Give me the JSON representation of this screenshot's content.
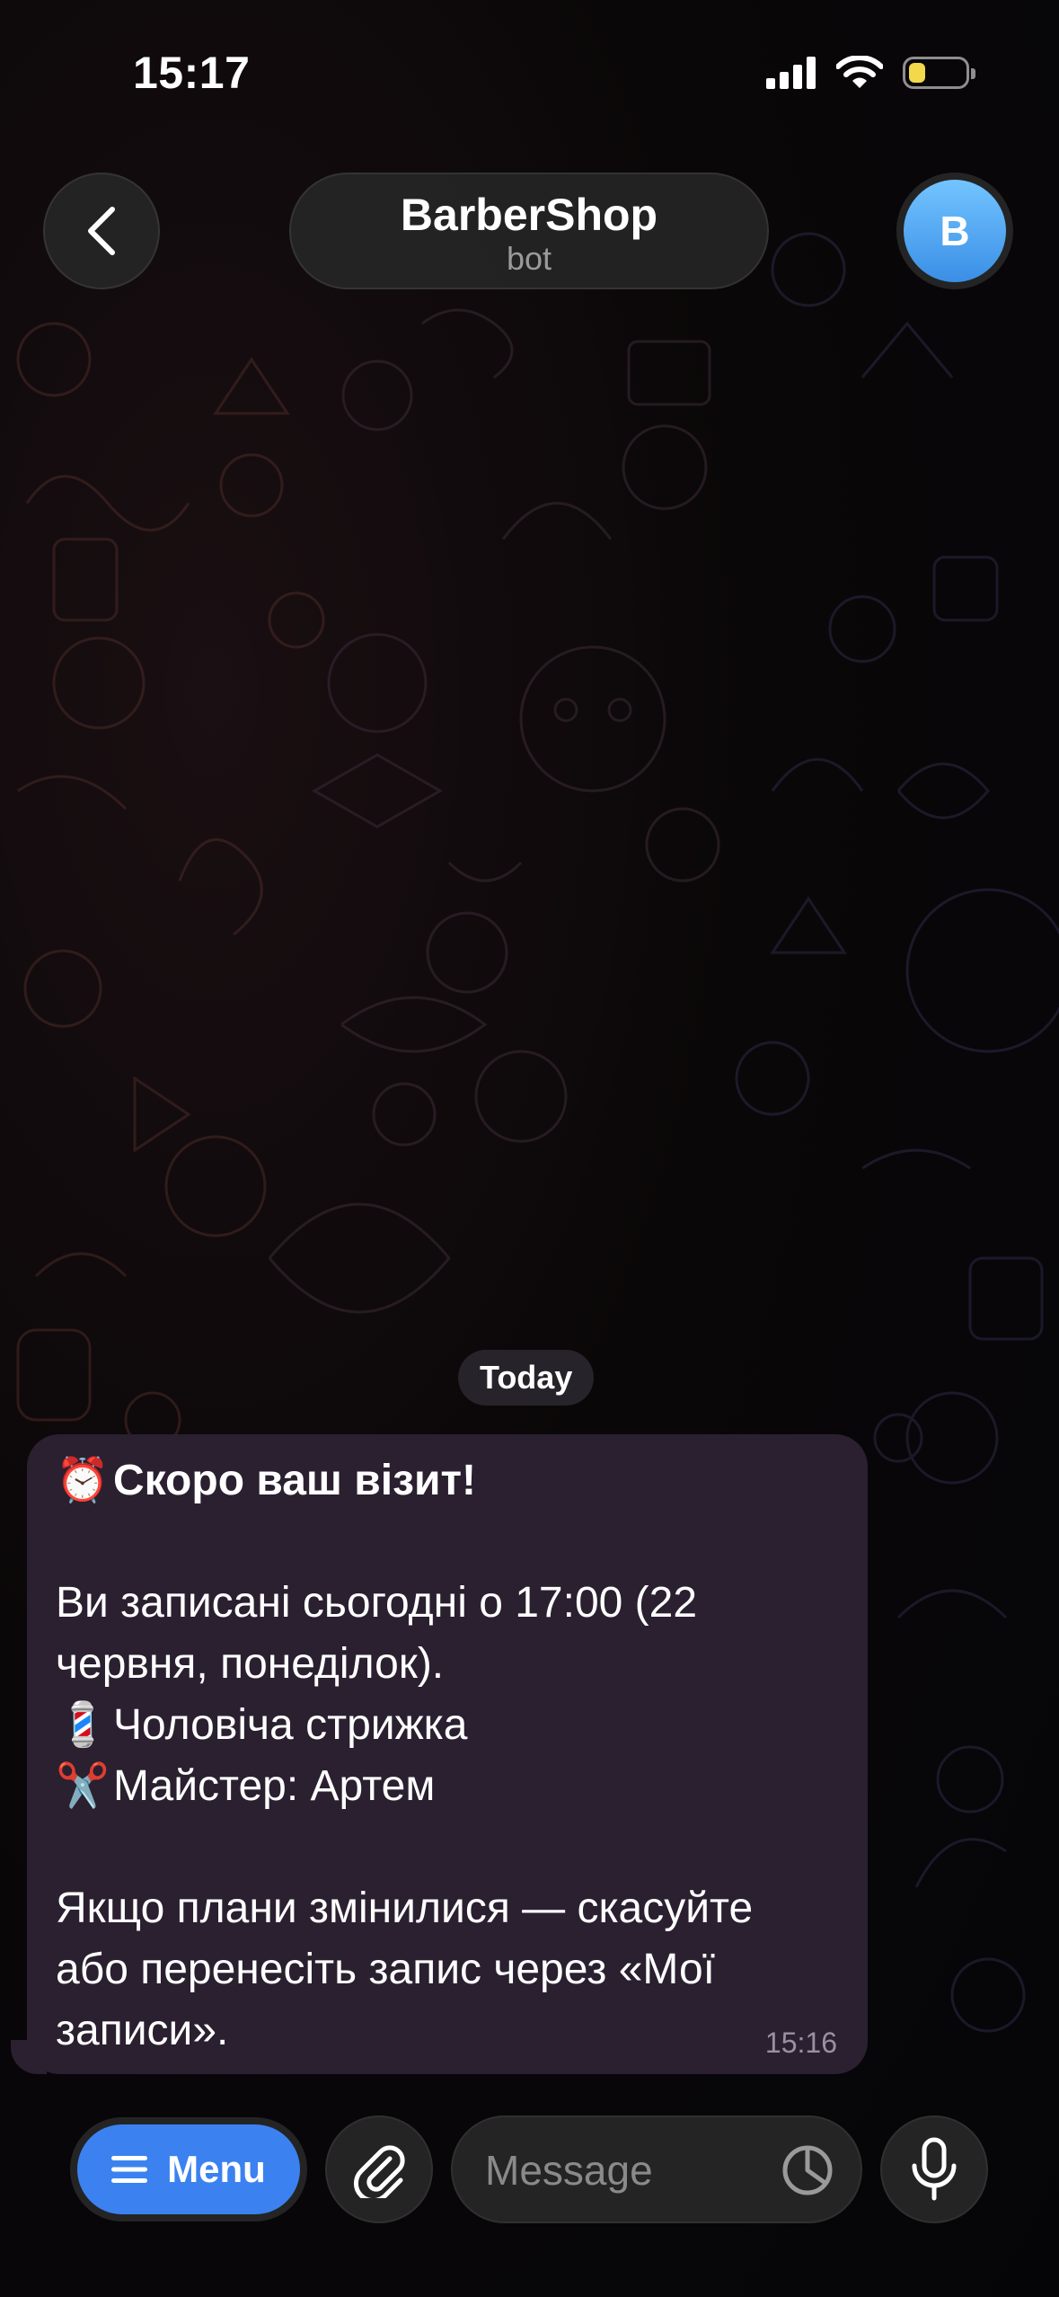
{
  "status_bar": {
    "time": "15:17",
    "battery_level": 0.3
  },
  "header": {
    "title": "BarberShop",
    "subtitle": "bot",
    "avatar_letter": "B"
  },
  "chat": {
    "date_label": "Today",
    "message": {
      "title_emoji": "⏰",
      "title": "Скоро ваш візит!",
      "line1": "Ви записані сьогодні о 17:00 (22",
      "line2": "червня, понеділок).",
      "service_emoji": "💈",
      "service": "Чоловіча стрижка",
      "master_emoji": "✂️",
      "master": "Майстер: Артем",
      "line3": "Якщо плани змінилися — скасуйте",
      "line4": "або перенесіть запис через «Мої",
      "line5": "записи».",
      "time": "15:16"
    }
  },
  "input_bar": {
    "menu_label": "Menu",
    "message_placeholder": "Message"
  },
  "colors": {
    "accent": "#3b82f0",
    "bubble": "#2a2030",
    "battery": "#f2d84a"
  }
}
